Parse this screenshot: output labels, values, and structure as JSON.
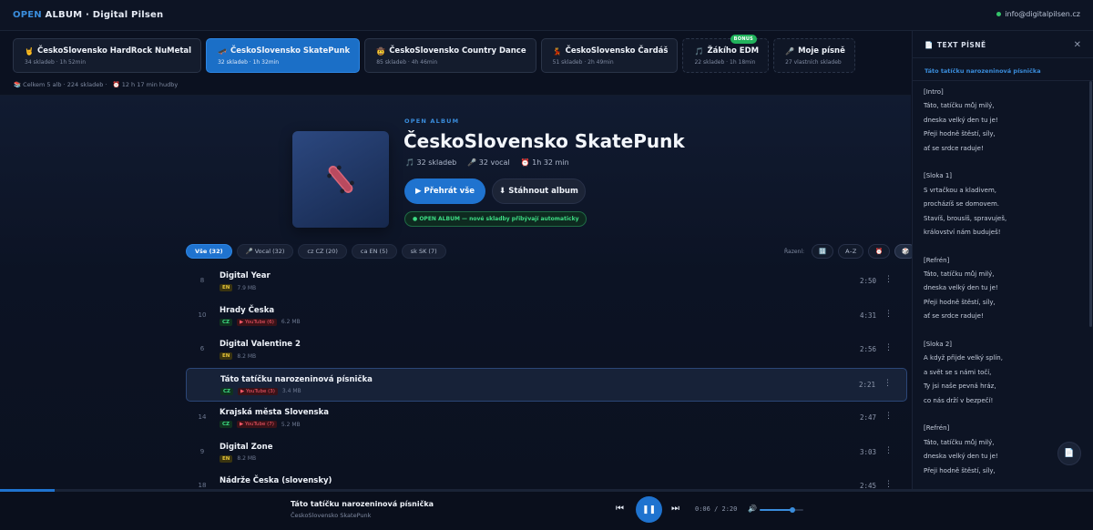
{
  "topbar": {
    "brand_open": "OPEN",
    "brand_rest": "ALBUM · Digital Pilsen",
    "contact": "info@digitalpilsen.cz"
  },
  "tabs": [
    {
      "icon": "🤘",
      "title": "ČeskoSlovensko HardRock NuMetal",
      "sub": "34 skladeb · 1h 52min",
      "active": false,
      "dashed": false,
      "bonus": ""
    },
    {
      "icon": "🛹",
      "title": "ČeskoSlovensko SkatePunk",
      "sub": "32 skladeb · 1h 32min",
      "active": true,
      "dashed": false,
      "bonus": ""
    },
    {
      "icon": "🤠",
      "title": "ČeskoSlovensko Country Dance",
      "sub": "85 skladeb · 4h 46min",
      "active": false,
      "dashed": false,
      "bonus": ""
    },
    {
      "icon": "💃",
      "title": "ČeskoSlovensko Čardáš",
      "sub": "51 skladeb · 2h 49min",
      "active": false,
      "dashed": false,
      "bonus": ""
    },
    {
      "icon": "🎵",
      "title": "Žákího EDM",
      "sub": "22 skladeb · 1h 18min",
      "active": false,
      "dashed": true,
      "bonus": "BONUS"
    },
    {
      "icon": "🎤",
      "title": "Moje písně",
      "sub": "27 vlastních skladeb",
      "active": false,
      "dashed": true,
      "bonus": ""
    }
  ],
  "summary": {
    "total": "📚 Celkem 5 alb · 224 skladeb ·",
    "duration": "⏰ 12 h 17 min hudby"
  },
  "album": {
    "kicker": "OPEN ALBUM",
    "title": "ČeskoSlovensko SkatePunk",
    "meta_tracks": "🎵 32 skladeb",
    "meta_vocal": "🎤 32 vocal",
    "meta_duration": "⏰ 1h 32 min",
    "play_label": "▶ Přehrát vše",
    "download_label": "⬇ Stáhnout album",
    "auto_badge": "● OPEN ALBUM — nové skladby přibývají automaticky",
    "cover_icon": "skateboard-icon"
  },
  "filters": [
    {
      "label": "Vše (32)",
      "active": true
    },
    {
      "label": "🎤 Vocal (32)",
      "active": false
    },
    {
      "label": "cz CZ (20)",
      "active": false
    },
    {
      "label": "ca EN (5)",
      "active": false
    },
    {
      "label": "sk SK (7)",
      "active": false
    }
  ],
  "sort": {
    "label": "Řazení:",
    "options": [
      {
        "label": "🔢",
        "active": false
      },
      {
        "label": "A–Z",
        "active": false
      },
      {
        "label": "⏰",
        "active": false
      },
      {
        "label": "🎲",
        "active": true
      }
    ]
  },
  "tracks": [
    {
      "num": "8",
      "title": "Digital Year",
      "lang": "EN",
      "youtube": "",
      "size": "7.9 MB",
      "duration": "2:50",
      "active": false
    },
    {
      "num": "10",
      "title": "Hrady Česka",
      "lang": "CZ",
      "youtube": "▶ YouTube (6)",
      "size": "6.2 MB",
      "duration": "4:31",
      "active": false
    },
    {
      "num": "6",
      "title": "Digital Valentine 2",
      "lang": "EN",
      "youtube": "",
      "size": "8.2 MB",
      "duration": "2:56",
      "active": false
    },
    {
      "num": "",
      "title": "Táto tatíčku narozeninová písnička",
      "lang": "CZ",
      "youtube": "▶ YouTube (3)",
      "size": "3.4 MB",
      "duration": "2:21",
      "active": true
    },
    {
      "num": "14",
      "title": "Krajská města Slovenska",
      "lang": "CZ",
      "youtube": "▶ YouTube (7)",
      "size": "5.2 MB",
      "duration": "2:47",
      "active": false
    },
    {
      "num": "9",
      "title": "Digital Zone",
      "lang": "EN",
      "youtube": "",
      "size": "8.2 MB",
      "duration": "3:03",
      "active": false
    },
    {
      "num": "18",
      "title": "Nádrže Česka (slovensky)",
      "lang": "SK",
      "youtube": "",
      "size": "",
      "duration": "2:45",
      "active": false
    }
  ],
  "lyrics_panel": {
    "heading": "TEXT PÍSNĚ",
    "heading_icon": "document-icon",
    "song": "Táto tatíčku narozeninová písnička",
    "lines": [
      "[Intro]",
      "Táto, tatíčku můj milý,",
      "dneska velký den tu je!",
      "Přeji hodně štěstí, síly,",
      "ať se srdce raduje!",
      "",
      "[Sloka 1]",
      "S vrtačkou a kladivem,",
      "procházíš se domovem.",
      "Stavíš, brousíš, spravuješ,",
      "království nám buduješ!",
      "",
      "[Refrén]",
      "Táto, tatíčku můj milý,",
      "dneska velký den tu je!",
      "Přeji hodně štěstí, síly,",
      "ať se srdce raduje!",
      "",
      "[Sloka 2]",
      "A když přijde velký splín,",
      "a svět se s námi točí,",
      "Ty jsi naše pevná hráz,",
      "co nás drží v bezpečí!",
      "",
      "[Refrén]",
      "Táto, tatíčku můj milý,",
      "dneska velký den tu je!",
      "Přeji hodně štěstí, síly,",
      "ať se srdce raduje!"
    ]
  },
  "player": {
    "title": "Táto tatíčku narozeninová písnička",
    "artist": "ČeskoSlovensko SkatePunk",
    "time": "0:06 / 2:20",
    "progress": 0.05,
    "volume": 0.75
  },
  "colors": {
    "accent": "#1f73cf",
    "background": "#0b1120",
    "green": "#3ddc84"
  }
}
